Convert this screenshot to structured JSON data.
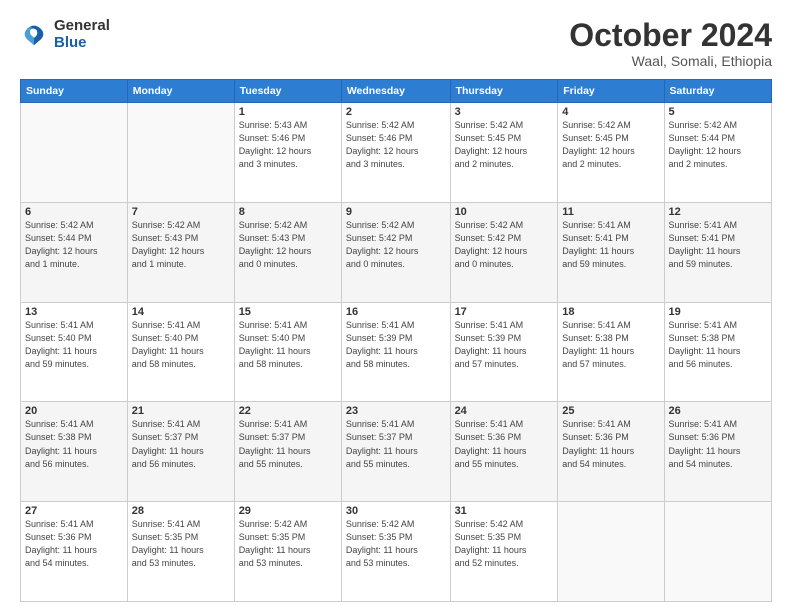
{
  "logo": {
    "general": "General",
    "blue": "Blue"
  },
  "title": "October 2024",
  "location": "Waal, Somali, Ethiopia",
  "days_of_week": [
    "Sunday",
    "Monday",
    "Tuesday",
    "Wednesday",
    "Thursday",
    "Friday",
    "Saturday"
  ],
  "weeks": [
    [
      {
        "day": "",
        "info": ""
      },
      {
        "day": "",
        "info": ""
      },
      {
        "day": "1",
        "info": "Sunrise: 5:43 AM\nSunset: 5:46 PM\nDaylight: 12 hours\nand 3 minutes."
      },
      {
        "day": "2",
        "info": "Sunrise: 5:42 AM\nSunset: 5:46 PM\nDaylight: 12 hours\nand 3 minutes."
      },
      {
        "day": "3",
        "info": "Sunrise: 5:42 AM\nSunset: 5:45 PM\nDaylight: 12 hours\nand 2 minutes."
      },
      {
        "day": "4",
        "info": "Sunrise: 5:42 AM\nSunset: 5:45 PM\nDaylight: 12 hours\nand 2 minutes."
      },
      {
        "day": "5",
        "info": "Sunrise: 5:42 AM\nSunset: 5:44 PM\nDaylight: 12 hours\nand 2 minutes."
      }
    ],
    [
      {
        "day": "6",
        "info": "Sunrise: 5:42 AM\nSunset: 5:44 PM\nDaylight: 12 hours\nand 1 minute."
      },
      {
        "day": "7",
        "info": "Sunrise: 5:42 AM\nSunset: 5:43 PM\nDaylight: 12 hours\nand 1 minute."
      },
      {
        "day": "8",
        "info": "Sunrise: 5:42 AM\nSunset: 5:43 PM\nDaylight: 12 hours\nand 0 minutes."
      },
      {
        "day": "9",
        "info": "Sunrise: 5:42 AM\nSunset: 5:42 PM\nDaylight: 12 hours\nand 0 minutes."
      },
      {
        "day": "10",
        "info": "Sunrise: 5:42 AM\nSunset: 5:42 PM\nDaylight: 12 hours\nand 0 minutes."
      },
      {
        "day": "11",
        "info": "Sunrise: 5:41 AM\nSunset: 5:41 PM\nDaylight: 11 hours\nand 59 minutes."
      },
      {
        "day": "12",
        "info": "Sunrise: 5:41 AM\nSunset: 5:41 PM\nDaylight: 11 hours\nand 59 minutes."
      }
    ],
    [
      {
        "day": "13",
        "info": "Sunrise: 5:41 AM\nSunset: 5:40 PM\nDaylight: 11 hours\nand 59 minutes."
      },
      {
        "day": "14",
        "info": "Sunrise: 5:41 AM\nSunset: 5:40 PM\nDaylight: 11 hours\nand 58 minutes."
      },
      {
        "day": "15",
        "info": "Sunrise: 5:41 AM\nSunset: 5:40 PM\nDaylight: 11 hours\nand 58 minutes."
      },
      {
        "day": "16",
        "info": "Sunrise: 5:41 AM\nSunset: 5:39 PM\nDaylight: 11 hours\nand 58 minutes."
      },
      {
        "day": "17",
        "info": "Sunrise: 5:41 AM\nSunset: 5:39 PM\nDaylight: 11 hours\nand 57 minutes."
      },
      {
        "day": "18",
        "info": "Sunrise: 5:41 AM\nSunset: 5:38 PM\nDaylight: 11 hours\nand 57 minutes."
      },
      {
        "day": "19",
        "info": "Sunrise: 5:41 AM\nSunset: 5:38 PM\nDaylight: 11 hours\nand 56 minutes."
      }
    ],
    [
      {
        "day": "20",
        "info": "Sunrise: 5:41 AM\nSunset: 5:38 PM\nDaylight: 11 hours\nand 56 minutes."
      },
      {
        "day": "21",
        "info": "Sunrise: 5:41 AM\nSunset: 5:37 PM\nDaylight: 11 hours\nand 56 minutes."
      },
      {
        "day": "22",
        "info": "Sunrise: 5:41 AM\nSunset: 5:37 PM\nDaylight: 11 hours\nand 55 minutes."
      },
      {
        "day": "23",
        "info": "Sunrise: 5:41 AM\nSunset: 5:37 PM\nDaylight: 11 hours\nand 55 minutes."
      },
      {
        "day": "24",
        "info": "Sunrise: 5:41 AM\nSunset: 5:36 PM\nDaylight: 11 hours\nand 55 minutes."
      },
      {
        "day": "25",
        "info": "Sunrise: 5:41 AM\nSunset: 5:36 PM\nDaylight: 11 hours\nand 54 minutes."
      },
      {
        "day": "26",
        "info": "Sunrise: 5:41 AM\nSunset: 5:36 PM\nDaylight: 11 hours\nand 54 minutes."
      }
    ],
    [
      {
        "day": "27",
        "info": "Sunrise: 5:41 AM\nSunset: 5:36 PM\nDaylight: 11 hours\nand 54 minutes."
      },
      {
        "day": "28",
        "info": "Sunrise: 5:41 AM\nSunset: 5:35 PM\nDaylight: 11 hours\nand 53 minutes."
      },
      {
        "day": "29",
        "info": "Sunrise: 5:42 AM\nSunset: 5:35 PM\nDaylight: 11 hours\nand 53 minutes."
      },
      {
        "day": "30",
        "info": "Sunrise: 5:42 AM\nSunset: 5:35 PM\nDaylight: 11 hours\nand 53 minutes."
      },
      {
        "day": "31",
        "info": "Sunrise: 5:42 AM\nSunset: 5:35 PM\nDaylight: 11 hours\nand 52 minutes."
      },
      {
        "day": "",
        "info": ""
      },
      {
        "day": "",
        "info": ""
      }
    ]
  ]
}
